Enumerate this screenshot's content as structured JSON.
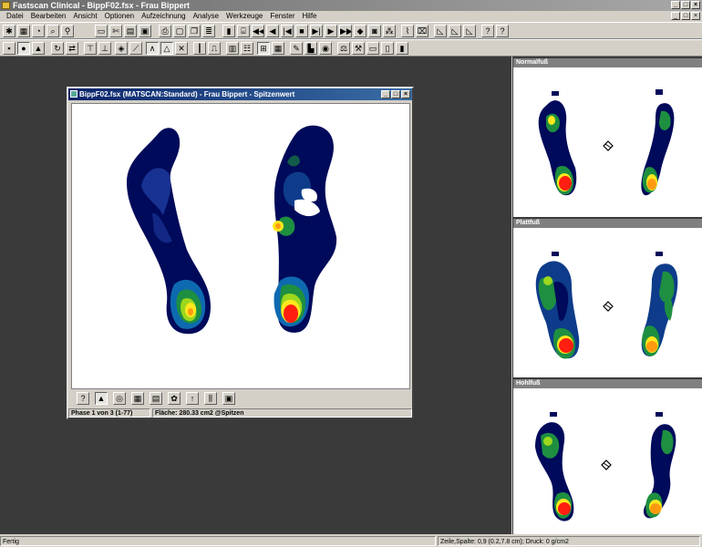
{
  "app": {
    "title": "Fastscan Clinical - BippF02.fsx - Frau  Bippert",
    "controls": [
      "_",
      "□",
      "×"
    ],
    "mdi_controls": [
      "_",
      "□",
      "×"
    ]
  },
  "menu": [
    "Datei",
    "Bearbeiten",
    "Ansicht",
    "Optionen",
    "Aufzeichnung",
    "Analyse",
    "Werkzeuge",
    "Fenster",
    "Hilfe"
  ],
  "toolbar1": [
    {
      "icon": "star-icon",
      "glyph": "✱"
    },
    {
      "icon": "grid-icon",
      "glyph": "▦"
    },
    {
      "icon": "zoom-icon",
      "glyph": "◔"
    },
    {
      "icon": "search-icon",
      "glyph": "⌕"
    },
    {
      "icon": "magnify-icon",
      "glyph": "⚲"
    },
    {
      "icon": "open-folder-icon",
      "glyph": "▭"
    },
    {
      "icon": "connect-icon",
      "glyph": "✄"
    },
    {
      "icon": "database-icon",
      "glyph": "▤"
    },
    {
      "icon": "save-icon",
      "glyph": "▣"
    },
    {
      "icon": "print-icon",
      "glyph": "⎙"
    },
    {
      "icon": "preview-icon",
      "glyph": "▢"
    },
    {
      "icon": "copy-icon",
      "glyph": "❐"
    },
    {
      "icon": "notes-icon",
      "glyph": "≣"
    },
    {
      "icon": "traffic-light-icon",
      "glyph": "▮"
    },
    {
      "icon": "record-icon",
      "glyph": "⌸"
    },
    {
      "icon": "rewind-icon",
      "glyph": "◀◀"
    },
    {
      "icon": "step-back-icon",
      "glyph": "◀"
    },
    {
      "icon": "first-frame-icon",
      "glyph": "|◀"
    },
    {
      "icon": "stop-icon",
      "glyph": "■"
    },
    {
      "icon": "last-frame-icon",
      "glyph": "▶|"
    },
    {
      "icon": "play-icon",
      "glyph": "▶"
    },
    {
      "icon": "fast-forward-icon",
      "glyph": "▶▶"
    },
    {
      "icon": "marker-icon",
      "glyph": "◆"
    },
    {
      "icon": "camera-icon",
      "glyph": "◙"
    },
    {
      "icon": "footsteps-icon",
      "glyph": "⁂"
    },
    {
      "icon": "brush-icon",
      "glyph": "⌇"
    },
    {
      "icon": "trash-icon",
      "glyph": "⌧"
    },
    {
      "icon": "chart-a-icon",
      "glyph": "◺"
    },
    {
      "icon": "chart-b-icon",
      "glyph": "◺"
    },
    {
      "icon": "chart-c-icon",
      "glyph": "◺"
    },
    {
      "icon": "help-icon",
      "glyph": "?"
    },
    {
      "icon": "context-help-icon",
      "glyph": "?"
    }
  ],
  "toolbar2": [
    {
      "icon": "sensor-icon",
      "glyph": "▪"
    },
    {
      "icon": "green-circle-icon",
      "glyph": "●"
    },
    {
      "icon": "terrain-icon",
      "glyph": "▲"
    },
    {
      "icon": "refresh-icon",
      "glyph": "↻"
    },
    {
      "icon": "swap-icon",
      "glyph": "⇄"
    },
    {
      "icon": "table-icon",
      "glyph": "⊤"
    },
    {
      "icon": "bench-icon",
      "glyph": "⊥"
    },
    {
      "icon": "diamond-icon",
      "glyph": "◈"
    },
    {
      "icon": "ruler-icon",
      "glyph": "⟋"
    },
    {
      "icon": "wave-icon",
      "glyph": "∧"
    },
    {
      "icon": "mountain-icon",
      "glyph": "△"
    },
    {
      "icon": "cross-icon",
      "glyph": "✕"
    },
    {
      "icon": "bar-icon",
      "glyph": "┃"
    },
    {
      "icon": "step-icon",
      "glyph": "⎍"
    },
    {
      "icon": "columns-icon",
      "glyph": "▥"
    },
    {
      "icon": "feet-icon",
      "glyph": "☷"
    },
    {
      "icon": "calc-icon",
      "glyph": "⊞"
    },
    {
      "icon": "area-icon",
      "glyph": "▦"
    },
    {
      "icon": "pen-icon",
      "glyph": "✎"
    },
    {
      "icon": "chart-icon",
      "glyph": "▙"
    },
    {
      "icon": "pressure-icon",
      "glyph": "◉"
    },
    {
      "icon": "balance-icon",
      "glyph": "⚖"
    },
    {
      "icon": "wrench-icon",
      "glyph": "⚒"
    },
    {
      "icon": "layout-a-icon",
      "glyph": "▭"
    },
    {
      "icon": "layout-b-icon",
      "glyph": "▯"
    },
    {
      "icon": "layout-c-icon",
      "glyph": "▮"
    }
  ],
  "child_window": {
    "title": "BippF02.fsx (MATSCAN:Standard) - Frau  Bippert - Spitzenwert",
    "tools": [
      {
        "icon": "query-icon",
        "glyph": "?"
      },
      {
        "icon": "peak-icon",
        "glyph": "▲"
      },
      {
        "icon": "cop-icon",
        "glyph": "◎"
      },
      {
        "icon": "grid-view-icon",
        "glyph": "▦"
      },
      {
        "icon": "table-view-icon",
        "glyph": "▤"
      },
      {
        "icon": "colors-icon",
        "glyph": "✿"
      },
      {
        "icon": "graph-icon",
        "glyph": "↑"
      },
      {
        "icon": "levels-icon",
        "glyph": "⫼"
      },
      {
        "icon": "export-icon",
        "glyph": "▣"
      }
    ],
    "status_phase": "Phase 1 von 3 (1-77)",
    "status_area": "Fläche: 280.33 cm2 @Spitzen"
  },
  "reference_panes": [
    {
      "label": "Normalfuß"
    },
    {
      "label": "Plattfuß"
    },
    {
      "label": "Hohlfuß"
    }
  ],
  "status": {
    "left": "Fertig",
    "right": "Zeile,Spalte: 0,9 (0.2,7.8 cm); Druck: 0 g/cm2"
  },
  "colors": {
    "workspace": "#3a3a3a",
    "pressure_low": "#000a5a",
    "pressure_mid": "#1e8f40",
    "pressure_high": "#ff1e10"
  }
}
